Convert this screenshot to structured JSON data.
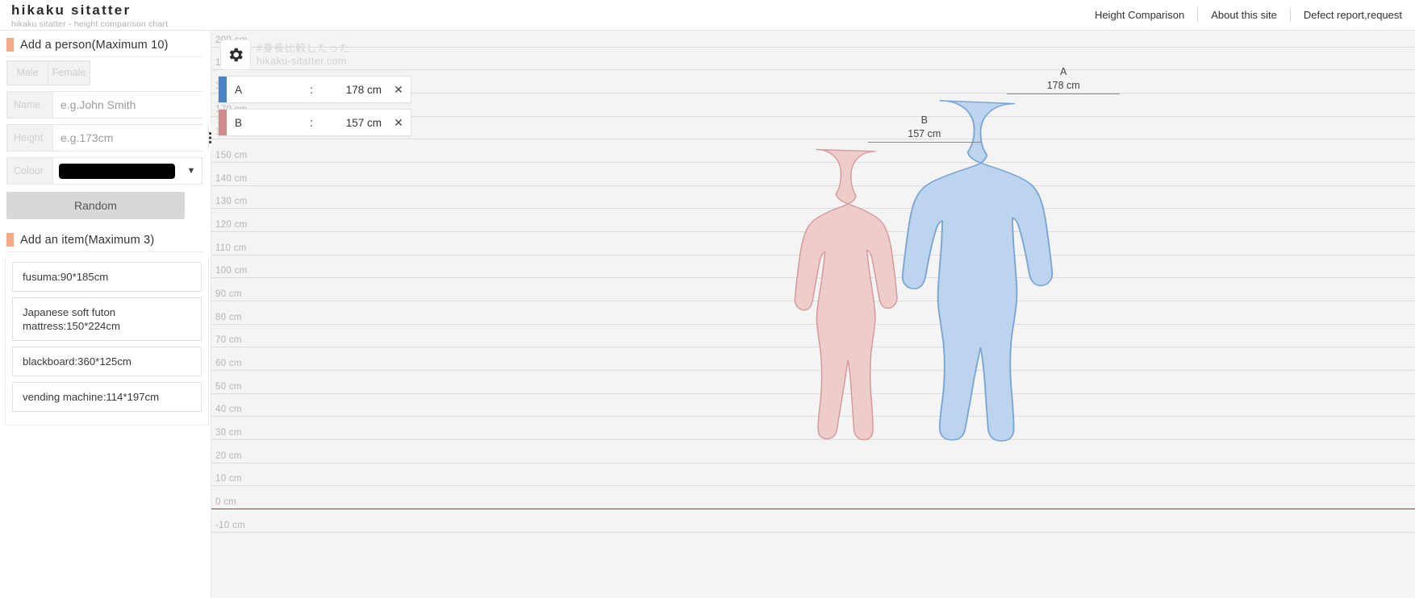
{
  "header": {
    "brand_title": "hikaku sitatter",
    "brand_subtitle": "hikaku sitatter - height comparison chart",
    "nav": [
      {
        "label": "Height Comparison"
      },
      {
        "label": "About this site"
      },
      {
        "label": "Defect report,request"
      }
    ]
  },
  "sidebar": {
    "person_section": {
      "title": "Add a person(Maximum 10)",
      "gender": {
        "male_label": "Male",
        "female_label": "Female"
      },
      "name_field": {
        "label": "Name",
        "value": "",
        "placeholder": "e.g.John Smith"
      },
      "height_field": {
        "label": "Height",
        "value": "",
        "placeholder": "e.g.173cm",
        "list_icon": "list-icon"
      },
      "colour_field": {
        "label": "Colour",
        "swatch_color": "#000000",
        "caret_icon": "chevron-down-icon"
      },
      "random_label": "Random"
    },
    "item_section": {
      "title": "Add an item(Maximum 3)",
      "items": [
        {
          "label": "fusuma:90*185cm"
        },
        {
          "label": "Japanese soft futon mattress:150*224cm"
        },
        {
          "label": "blackboard:360*125cm"
        },
        {
          "label": "vending machine:114*197cm"
        }
      ]
    }
  },
  "chart_panel": {
    "gear_icon": "gear-icon",
    "watermark_line1": "#身長比較したった",
    "watermark_line2": "hikaku-sitatter.com",
    "person_cards": [
      {
        "name": "A",
        "colon": ":",
        "height": "178 cm",
        "color": "#4a82c3",
        "close_icon": "close-icon"
      },
      {
        "name": "B",
        "colon": ":",
        "height": "157 cm",
        "color": "#cf8a8a",
        "close_icon": "close-icon"
      }
    ]
  },
  "chart_data": {
    "type": "bar",
    "title": "Height comparison chart",
    "xlabel": "",
    "ylabel": "cm",
    "ylim": [
      -10,
      200
    ],
    "grid": true,
    "legend_position": "top-left",
    "axis_tick_labels": [
      "200 cm",
      "190 cm",
      "180 cm",
      "170 cm",
      "160 cm",
      "150 cm",
      "140 cm",
      "130 cm",
      "120 cm",
      "110 cm",
      "100 cm",
      "90 cm",
      "80 cm",
      "70 cm",
      "60 cm",
      "50 cm",
      "40 cm",
      "30 cm",
      "20 cm",
      "10 cm",
      "0 cm",
      "-10 cm"
    ],
    "axis_tick_values": [
      200,
      190,
      180,
      170,
      160,
      150,
      140,
      130,
      120,
      110,
      100,
      90,
      80,
      70,
      60,
      50,
      40,
      30,
      20,
      10,
      0,
      -10
    ],
    "categories": [
      "A",
      "B"
    ],
    "values": [
      178,
      157
    ],
    "units": "cm",
    "series": [
      {
        "name": "A",
        "value": 178,
        "label": "178 cm",
        "color": "#4a82c3",
        "fill": "#bcd4ee",
        "gender": "male"
      },
      {
        "name": "B",
        "value": 157,
        "label": "157 cm",
        "color": "#cf8a8a",
        "fill": "#eecccc",
        "gender": "female"
      }
    ],
    "baseline_label": "0 cm",
    "baseline_color": "#a83232"
  }
}
